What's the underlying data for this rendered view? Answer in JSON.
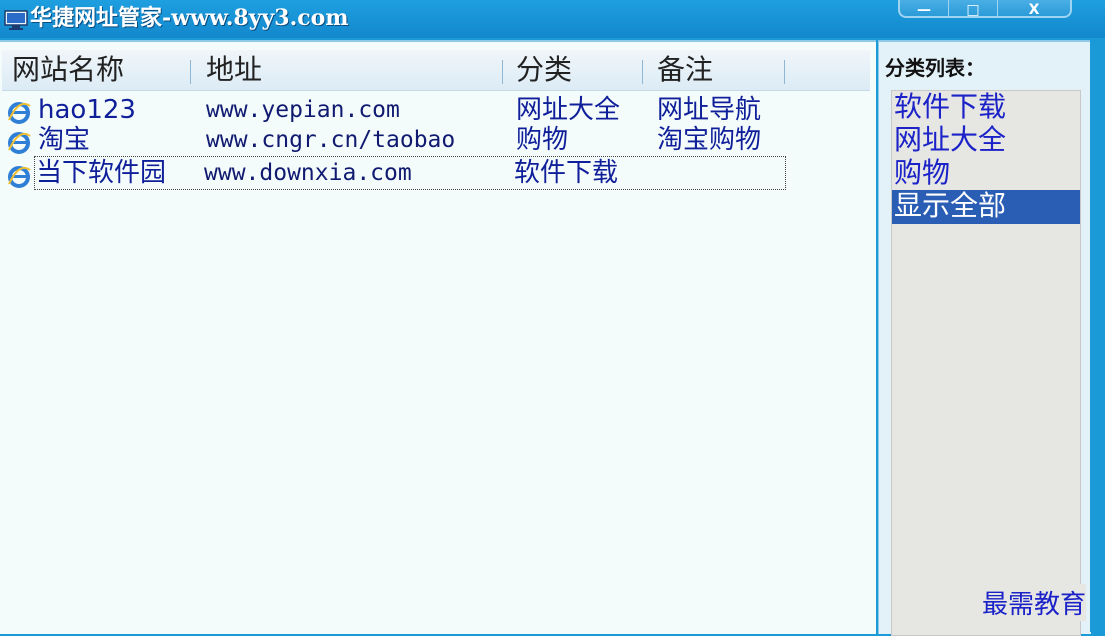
{
  "window": {
    "title": "华捷网址管家-www.8yy3.com",
    "buttons": {
      "minimize": "—",
      "maximize": "□",
      "close": "X"
    }
  },
  "list": {
    "headers": [
      "网站名称",
      "地址",
      "分类",
      "备注"
    ],
    "rows": [
      {
        "name": "hao123",
        "url": "www.yepian.com",
        "category": "网址大全",
        "note": "网址导航"
      },
      {
        "name": "淘宝",
        "url": "www.cngr.cn/taobao",
        "category": "购物",
        "note": "淘宝购物"
      },
      {
        "name": "当下软件园",
        "url": "www.downxia.com",
        "category": "软件下载",
        "note": ""
      }
    ]
  },
  "sidebar": {
    "title": "分类列表：",
    "items": [
      "软件下载",
      "网址大全",
      "购物",
      "显示全部"
    ],
    "active_index": 3
  },
  "watermark": "最需教育",
  "colors": {
    "titlebar": "#1388cc",
    "accent": "#2a5eb4",
    "link_text": "#1a22c8"
  }
}
